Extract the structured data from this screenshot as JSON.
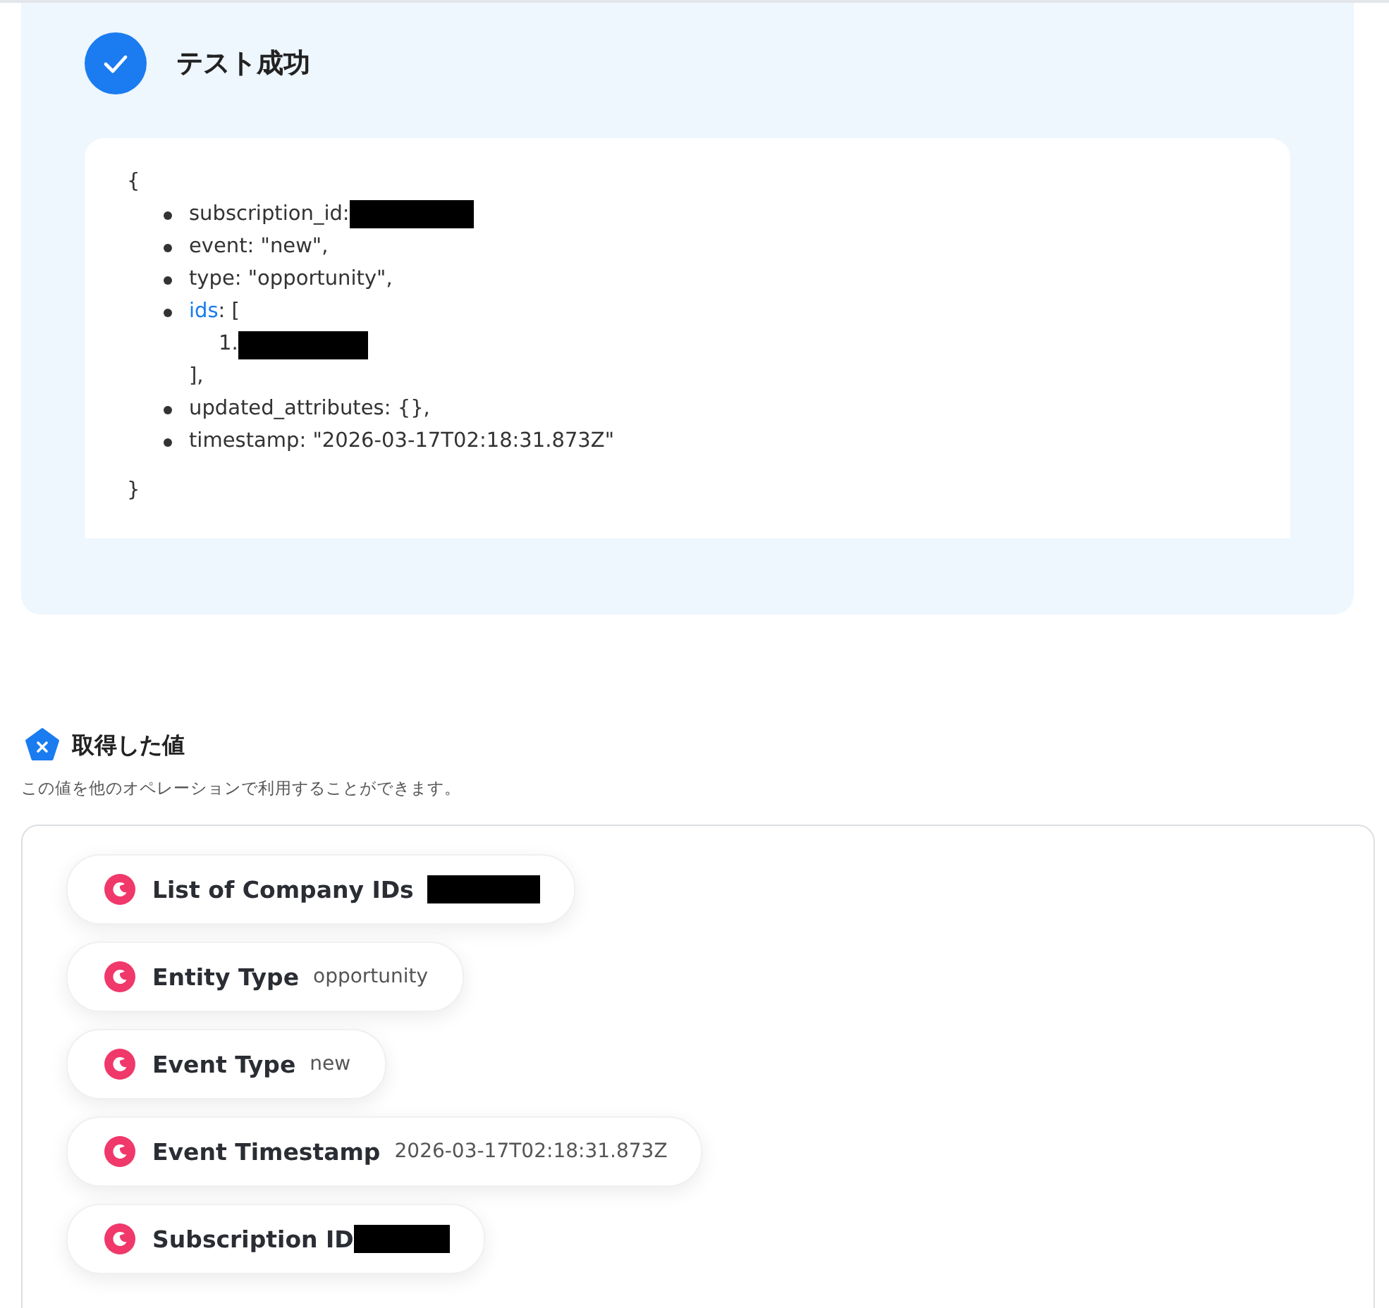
{
  "result": {
    "title": "テスト成功",
    "open": "{",
    "close": "}",
    "entries": [
      {
        "text": "subscription_id:",
        "redacted": true
      },
      {
        "text": "event: \"new\",",
        "redacted": false
      },
      {
        "text": "type: \"opportunity\",",
        "redacted": false
      },
      {
        "key": "ids",
        "text": ": [",
        "redacted": false,
        "items": [
          {
            "number": "1.",
            "redacted": true
          }
        ],
        "end": "],"
      },
      {
        "text": "updated_attributes: {},",
        "redacted": false
      },
      {
        "text": "timestamp: \"2026-03-17T02:18:31.873Z\"",
        "redacted": false
      }
    ]
  },
  "values": {
    "title": "取得した値",
    "description": "この値を他のオペレーションで利用することができます。",
    "items": [
      {
        "label": "List of Company IDs",
        "redacted": true,
        "tight": false
      },
      {
        "label": "Entity Type",
        "value": "opportunity",
        "redacted": false,
        "tight": false
      },
      {
        "label": "Event Type",
        "value": "new",
        "redacted": false,
        "tight": false
      },
      {
        "label": "Event Timestamp",
        "value": "2026-03-17T02:18:31.873Z",
        "redacted": false,
        "tight": false
      },
      {
        "label": "Subscription ID",
        "redacted": true,
        "tight": true
      }
    ]
  }
}
